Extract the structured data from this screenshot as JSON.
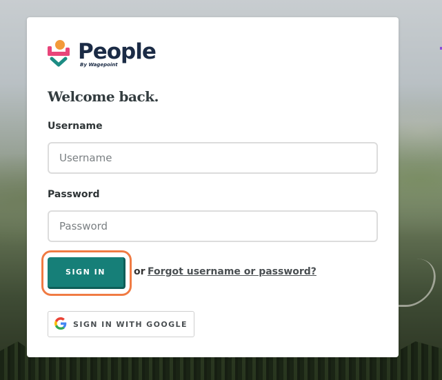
{
  "brand": {
    "name": "People",
    "subtitle": "By Wagepoint",
    "colors": {
      "navy": "#1b2b45",
      "orange": "#f39a3a",
      "pink": "#e8457a",
      "teal": "#167f78"
    }
  },
  "form": {
    "heading": "Welcome back.",
    "username": {
      "label": "Username",
      "placeholder": "Username"
    },
    "password": {
      "label": "Password",
      "placeholder": "Password"
    },
    "sign_in_label": "SIGN IN",
    "or_text": "or",
    "forgot_link": "Forgot username or password?",
    "google_label": "SIGN IN WITH GOOGLE"
  },
  "icons": {
    "google": "google-g-icon",
    "logo": "people-logo-icon"
  },
  "accent": {
    "focus_ring": "#f07b43",
    "button": "#167f78"
  }
}
